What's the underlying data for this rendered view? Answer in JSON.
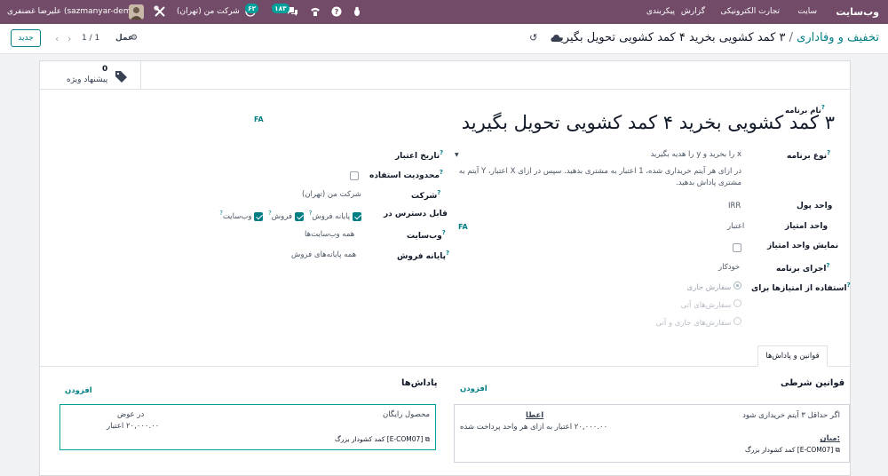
{
  "navbar": {
    "brand": "وب‌سایت",
    "menu": [
      "سایت",
      "تجارت الکترونیکی",
      "گزارش",
      "پیکربندی"
    ],
    "company": "شرکت من (تهران)",
    "activity_count": "۶۲",
    "message_count": "۱۸۳",
    "user": "علیرضا غضنفری (sazmanyar-demo)"
  },
  "controlbar": {
    "new_label": "جدید",
    "breadcrumb_parent": "تخفیف و وفاداری",
    "breadcrumb_sep": "/",
    "breadcrumb_current": "۳ کمد کشویی بخرید ۴ کمد کشویی تحویل بگیرید",
    "pager": "1 / 1",
    "action_label": "عمل"
  },
  "smart_button": {
    "count": "0",
    "label": "پیشنهاد ویژه"
  },
  "form": {
    "name_label": "نام برنامه",
    "name_value": "۳ کمد کشویی بخرید ۴ کمد کشویی تحویل بگیرید",
    "lang_badge": "FA",
    "lang_badge_2": "FA",
    "program_type_label": "نوع برنامه",
    "program_type_value": "x را بخرید و y را هدیه بگیرید",
    "program_type_desc": "در ازای هر آیتم خریداری شده، 1 اعتبار به مشتری بدهید. سپس در ازای X اعتبار، Y آیتم به مشتری پاداش بدهید.",
    "currency_label": "واحد پول",
    "currency_value": "IRR",
    "points_unit_label": "واحد امتیاز",
    "points_unit_value": "اعتبار",
    "show_points_label": "نمایش واحد امتیاز",
    "trigger_label": "اجرای برنامه",
    "trigger_value": "خودکار",
    "use_points_label": "استفاده از امتیازها برای",
    "use_points_options": [
      "سفارش جاری",
      "سفارش‌های آتی",
      "سفارش‌های جاری و آتی"
    ],
    "validity_label": "تاریخ اعتبار",
    "limit_usage_label": "محدودیت استفاده",
    "company_label": "شرکت",
    "company_value": "شرکت من (تهران)",
    "available_on_label": "قابل دسترس در",
    "available_on_options": [
      "پایانه فروش",
      "فروش",
      "وب‌سایت"
    ],
    "website_label": "وب‌سایت",
    "website_value": "همه وب‌سایت‌ها",
    "pos_label": "پایانه فروش",
    "pos_value": "همه پایانه‌های فروش"
  },
  "tabs": {
    "rules_rewards": "قوانین و پاداش‌ها"
  },
  "rules": {
    "title": "قوانین شرطی",
    "add": "افزودن",
    "card_line1": "اگر حداقل ۳ آیتم خریداری شود",
    "grant_label": "اعطا",
    "grant_value": "۲۰,۰۰۰.۰۰ اعتبار به ازای هر واحد پرداخت شده",
    "among_label": "میان:",
    "product": "[E-COM07] کمد کشودار بزرگ"
  },
  "rewards": {
    "title": "پاداش‌ها",
    "add": "افزودن",
    "card_type": "محصول رایگان",
    "in_exchange_label": "در عوض",
    "in_exchange_value": "۲۰,۰۰۰.۰۰ اعتبار",
    "product": "[E-COM07] کمد کشودار بزرگ"
  },
  "colors": {
    "navbar": "#714b67",
    "accent": "#017e84",
    "badge_green": "#00a09d"
  }
}
